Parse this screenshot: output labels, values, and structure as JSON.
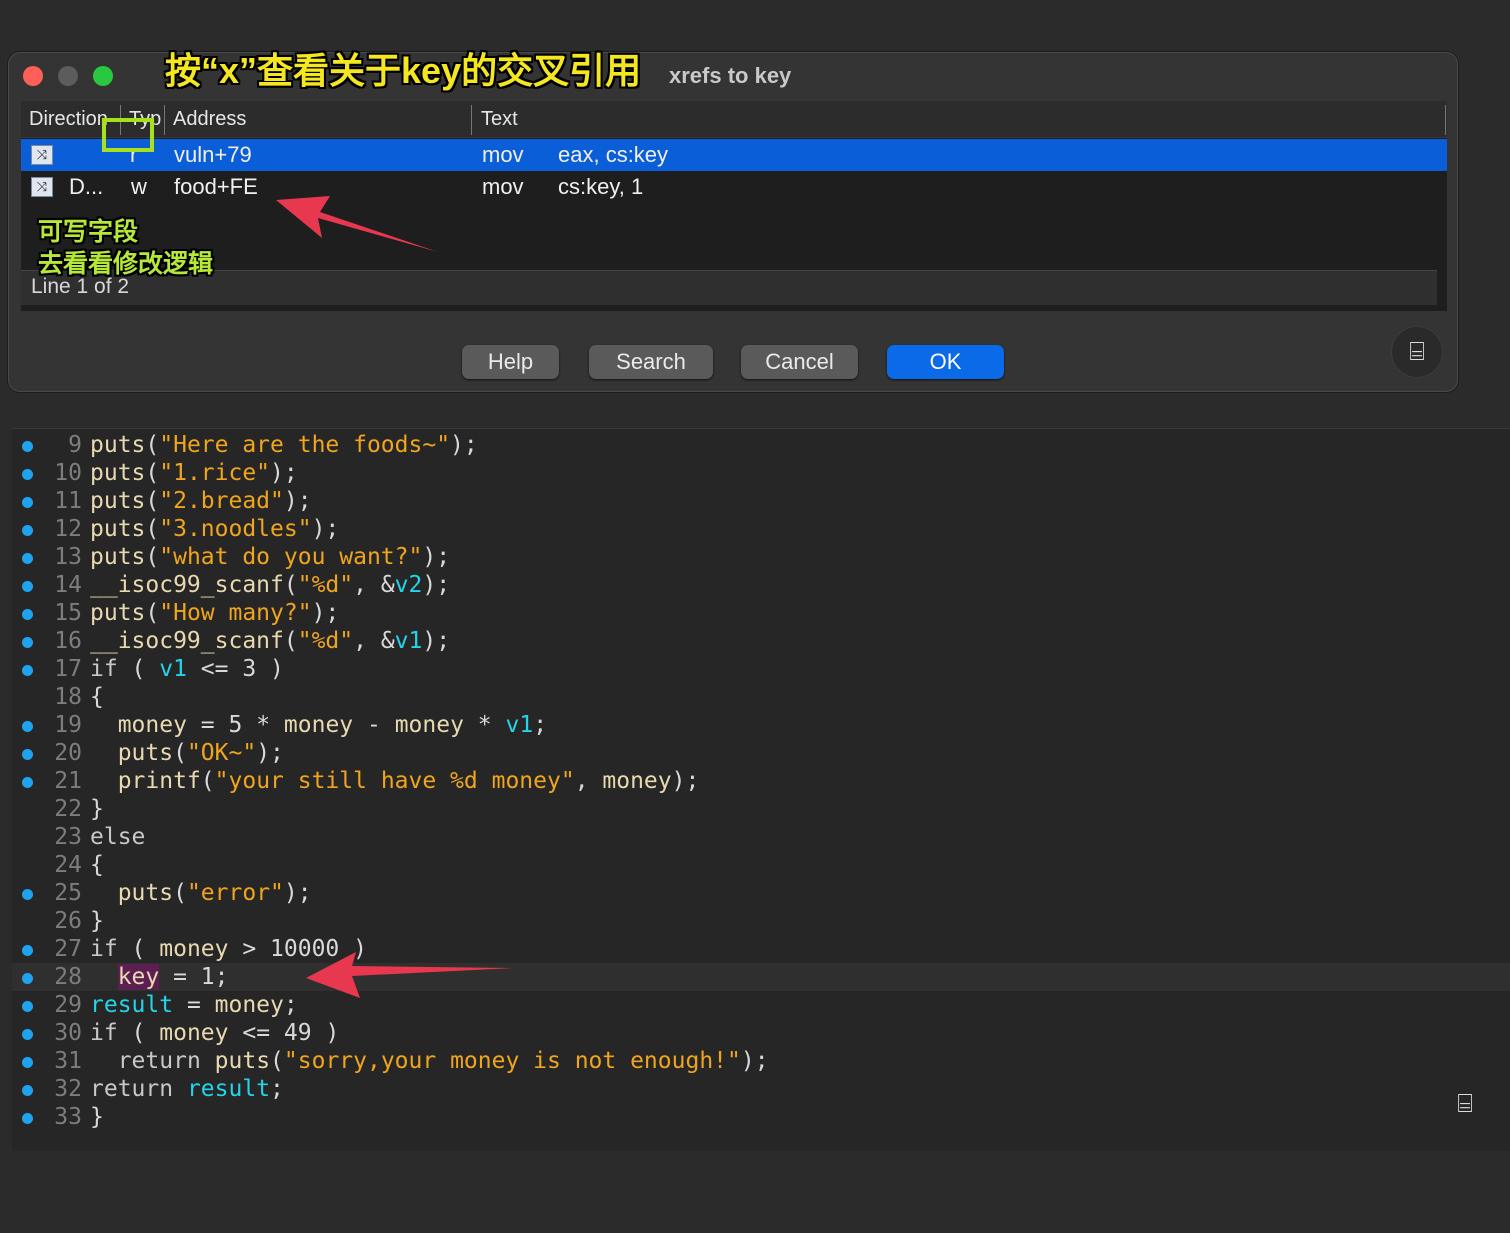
{
  "dialog": {
    "title": "xrefs to key",
    "columns": {
      "direction": "Direction",
      "type": "Typ",
      "address": "Address",
      "text": "Text"
    },
    "rows": [
      {
        "direction": "",
        "type": "r",
        "address": "vuln+79",
        "mnemonic": "mov",
        "operands": "eax, cs:key",
        "icon": "xref-icon",
        "selected": true
      },
      {
        "direction": "D...",
        "type": "w",
        "address": "food+FE",
        "mnemonic": "mov",
        "operands": "cs:key, 1",
        "icon": "xref-icon",
        "selected": false
      }
    ],
    "status": "Line 1 of 2",
    "buttons": {
      "help": "Help",
      "search": "Search",
      "cancel": "Cancel",
      "ok": "OK"
    }
  },
  "annotations": {
    "top": "按“x”查看关于key的交叉引用",
    "side1": "可写字段",
    "side2": "去看看修改逻辑",
    "arrow_color": "#e8384f",
    "highlight_color": "#a8e01c"
  },
  "code": {
    "lines": [
      {
        "n": "9",
        "bp": true
      },
      {
        "n": "10",
        "bp": true
      },
      {
        "n": "11",
        "bp": true
      },
      {
        "n": "12",
        "bp": true
      },
      {
        "n": "13",
        "bp": true
      },
      {
        "n": "14",
        "bp": true
      },
      {
        "n": "15",
        "bp": true
      },
      {
        "n": "16",
        "bp": true
      },
      {
        "n": "17",
        "bp": true
      },
      {
        "n": "18",
        "bp": false
      },
      {
        "n": "19",
        "bp": true
      },
      {
        "n": "20",
        "bp": true
      },
      {
        "n": "21",
        "bp": true
      },
      {
        "n": "22",
        "bp": false
      },
      {
        "n": "23",
        "bp": false
      },
      {
        "n": "24",
        "bp": false
      },
      {
        "n": "25",
        "bp": true
      },
      {
        "n": "26",
        "bp": false
      },
      {
        "n": "27",
        "bp": true
      },
      {
        "n": "28",
        "bp": true
      },
      {
        "n": "29",
        "bp": true
      },
      {
        "n": "30",
        "bp": true
      },
      {
        "n": "31",
        "bp": true
      },
      {
        "n": "32",
        "bp": true
      },
      {
        "n": "33",
        "bp": true
      }
    ],
    "tokens": {
      "puts": "puts",
      "scanf": "__isoc99_scanf",
      "printf": "printf",
      "s_foods": "\"Here are the foods~\"",
      "s_rice": "\"1.rice\"",
      "s_bread": "\"2.bread\"",
      "s_noodles": "\"3.noodles\"",
      "s_want": "\"what do you want?\"",
      "s_fmt": "\"%d\"",
      "s_many": "\"How many?\"",
      "s_ok": "\"OK~\"",
      "s_still": "\"your still have %d money\"",
      "s_error": "\"error\"",
      "s_sorry": "\"sorry,your money is not enough!\"",
      "v1": "v1",
      "v2": "v2",
      "money": "money",
      "key": "key",
      "result": "result",
      "kw_if": "if",
      "kw_else": "else",
      "kw_return": "return",
      "n3": "3",
      "n5": "5",
      "n1": "1",
      "n10000": "10000",
      "n49": "49"
    }
  }
}
